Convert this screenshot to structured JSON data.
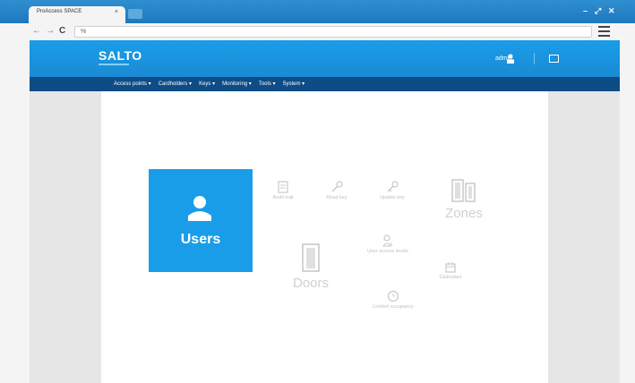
{
  "browser": {
    "tab_title": "ProAccess SPACE",
    "tab_close": "×",
    "window_controls": {
      "minimize": "–",
      "maximize": "⤢",
      "close": "✕"
    },
    "nav": {
      "back": "←",
      "forward": "→",
      "reload": "C"
    },
    "address": "%"
  },
  "header": {
    "logo": "SALTO",
    "user_name": "admin",
    "icons": [
      "user-icon",
      "logout-icon"
    ],
    "accent_color": "#1a9de8",
    "navbar_color": "#0e4c86"
  },
  "navbar": {
    "items": [
      "Access points ▾",
      "Cardholders ▾",
      "Keys ▾",
      "Monitoring ▾",
      "Tools ▾",
      "System ▾"
    ]
  },
  "dashboard": {
    "users": {
      "label": "Users",
      "icon": "user-icon"
    },
    "doors": {
      "label": "Doors",
      "icon": "door-icon"
    },
    "zones": {
      "label": "Zones",
      "icon": "zones-icon"
    },
    "small_items": [
      {
        "id": "audit",
        "label": "Audit trail",
        "icon": "audit-icon"
      },
      {
        "id": "read-key",
        "label": "Read key",
        "icon": "read-key-icon"
      },
      {
        "id": "update-key",
        "label": "Update key",
        "icon": "update-key-icon"
      },
      {
        "id": "user-access-levels",
        "label": "User access levels",
        "icon": "access-level-icon"
      },
      {
        "id": "calendars",
        "label": "Calendars",
        "icon": "calendar-icon"
      },
      {
        "id": "limited-occupancy",
        "label": "Limited occupancy",
        "icon": "clock-icon"
      }
    ]
  }
}
